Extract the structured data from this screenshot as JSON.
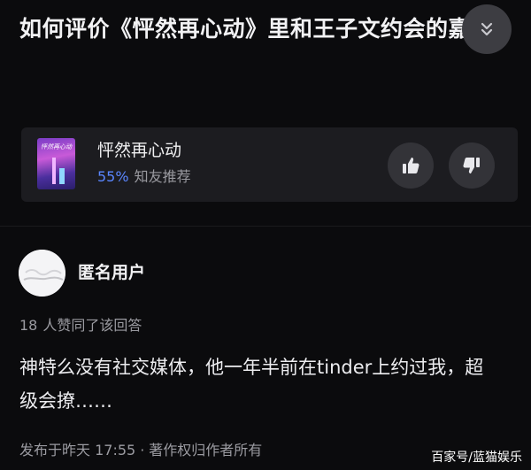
{
  "question": {
    "title": "如何评价《怦然再心动》里和王子文约会的嘉宾吴永恩？"
  },
  "icons": {
    "collapse": "chevrons-down-icon",
    "thumbs_up": "thumbs-up-icon",
    "thumbs_down": "thumbs-down-icon",
    "avatar": "anonymous-avatar"
  },
  "show_card": {
    "poster_text": "怦然再心动",
    "name": "怦然再心动",
    "rating_percent": "55%",
    "rating_label": "知友推荐",
    "rating_color": "#5a86ff"
  },
  "answer": {
    "author": "匿名用户",
    "upvote_count": "18",
    "upvote_text": "人赞同了该回答",
    "body": "神特么没有社交媒体，他一年半前在tinder上约过我，超级会撩……",
    "published": "发布于昨天 17:55",
    "separator": "·",
    "copyright": "著作权归作者所有"
  },
  "watermark": "百家号/蓝猫娱乐"
}
